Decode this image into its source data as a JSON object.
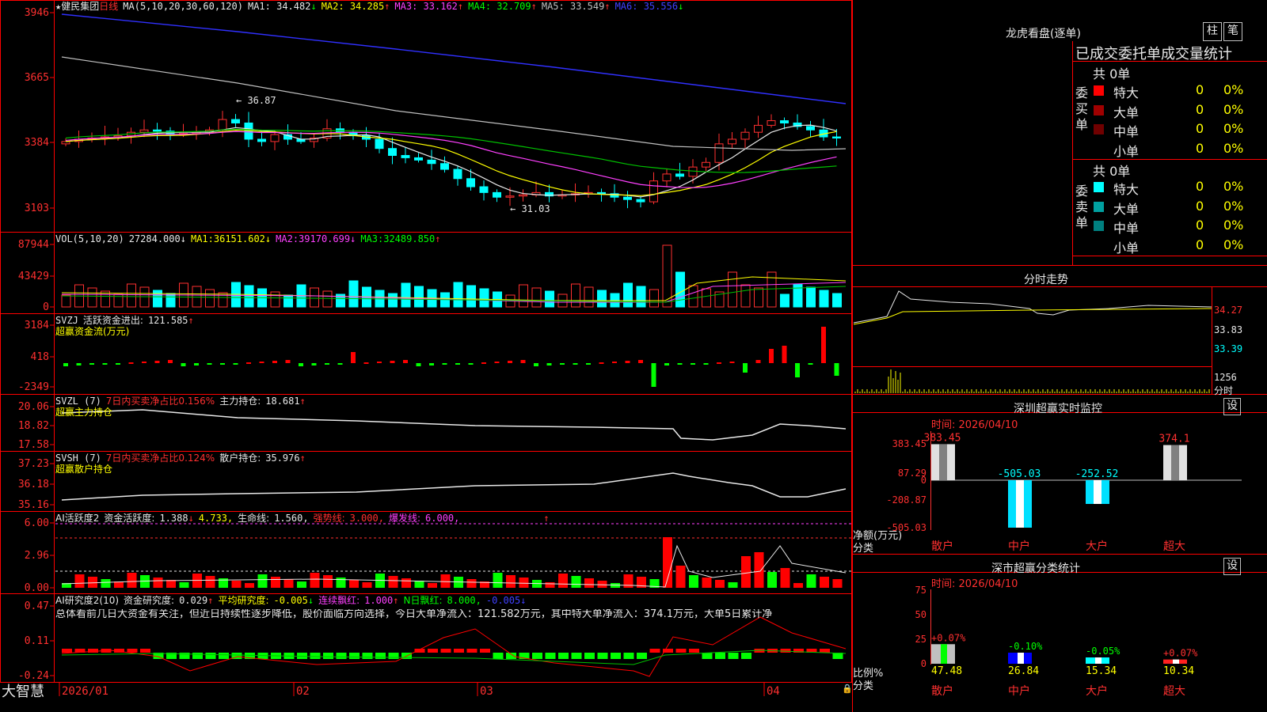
{
  "stock": {
    "star": "★",
    "name": "健民集团",
    "period": "日线"
  },
  "main_chart": {
    "ma_label": "MA(5,10,20,30,60,120)",
    "ma": [
      {
        "label": "MA1:",
        "value": "34.482",
        "arrow": "↓",
        "color": "#e8e8e8"
      },
      {
        "label": "MA2:",
        "value": "34.285",
        "arrow": "↑",
        "color": "#ffff00"
      },
      {
        "label": "MA3:",
        "value": "33.162",
        "arrow": "↑",
        "color": "#ff40ff"
      },
      {
        "label": "MA4:",
        "value": "32.709",
        "arrow": "↑",
        "color": "#00ff00"
      },
      {
        "label": "MA5:",
        "value": "33.549",
        "arrow": "↑",
        "color": "#c0c0c0"
      },
      {
        "label": "MA6:",
        "value": "35.556",
        "arrow": "↓",
        "color": "#4040ff"
      }
    ],
    "yticks": [
      "3946",
      "3665",
      "3384",
      "3103"
    ],
    "high_mark": "36.87",
    "low_mark": "31.03"
  },
  "vol": {
    "label": "VOL(5,10,20)",
    "value": "27284.000",
    "arrow": "↓",
    "ma": [
      {
        "label": "MA1:",
        "value": "36151.602",
        "arrow": "↓"
      },
      {
        "label": "MA2:",
        "value": "39170.699",
        "arrow": "↓"
      },
      {
        "label": "MA3:",
        "value": "32489.850",
        "arrow": "↑"
      }
    ],
    "yticks": [
      "87944",
      "43429",
      "0"
    ]
  },
  "svzj": {
    "label": "SVZJ",
    "title": "活跃资金进出:",
    "value": "121.585",
    "arrow": "↑",
    "sub": "超赢资金流(万元)",
    "yticks": [
      "3184",
      "418",
      "-2349"
    ]
  },
  "svzl": {
    "label": "SVZL (7)",
    "ratio_text": "7日内买卖净占比0.156%",
    "title": "主力持仓:",
    "value": "18.681",
    "arrow": "↑",
    "sub": "超赢主力持仓",
    "yticks": [
      "20.06",
      "18.82",
      "17.58"
    ]
  },
  "svsh": {
    "label": "SVSH (7)",
    "ratio_text": "7日内买卖净占比0.124%",
    "title": "散户持仓:",
    "value": "35.976",
    "arrow": "↑",
    "sub": "超赢散户持仓",
    "yticks": [
      "37.23",
      "36.18",
      "35.16"
    ]
  },
  "ai_active": {
    "label": "AI活跃度2",
    "title": "资金活跃度:",
    "value": "1.388",
    "arrow": "↓",
    "v2": "4.733,",
    "life": "生命线:",
    "life_value": "1.560,",
    "strong": "强势线:",
    "strong_value": "3.000,",
    "burst": "爆发线:",
    "burst_value": "6.000,",
    "tail_arrow": "↑",
    "yticks": [
      "6.00",
      "2.96",
      "0.00"
    ]
  },
  "ai_research": {
    "label": "AI研究度2(10)",
    "title": "资金研究度:",
    "value": "0.029",
    "arrow": "↑",
    "avg": "平均研究度:",
    "avg_value": "-0.005",
    "avg_arrow": "↓",
    "lian": "连续飘红:",
    "lian_value": "1.000",
    "lian_arrow": "↑",
    "n": "N日飘红:",
    "n_value": "8.000,",
    "tail": "-0.005",
    "tail_arrow": "↓",
    "summary": "总体看前几日大资金有关注，但近日持续性逐步降低，股价面临方向选择，今日大单净流入：121.582万元，其中特大单净流入：374.1万元，大单5日累计净",
    "yticks": [
      "0.47",
      "0.11",
      "-0.24"
    ]
  },
  "xaxis": {
    "brand": "大智慧",
    "labels": [
      "2026/01",
      "02",
      "03",
      "04"
    ]
  },
  "dragon": {
    "title": "龙虎看盘(逐单)",
    "btn1": "柱",
    "btn2": "笔",
    "header": "已成交委托单成交量统计",
    "buy": {
      "side": "委\n买\n单",
      "total": "共 0单",
      "rows": [
        {
          "name": "特大",
          "n": "0",
          "p": "0%",
          "color": "#ff0000"
        },
        {
          "name": "大单",
          "n": "0",
          "p": "0%",
          "color": "#a00000"
        },
        {
          "name": "中单",
          "n": "0",
          "p": "0%",
          "color": "#700000"
        },
        {
          "name": "小单",
          "n": "0",
          "p": "0%",
          "color": ""
        }
      ]
    },
    "sell": {
      "side": "委\n卖\n单",
      "total": "共 0单",
      "rows": [
        {
          "name": "特大",
          "n": "0",
          "p": "0%",
          "color": "#00ffff"
        },
        {
          "name": "大单",
          "n": "0",
          "p": "0%",
          "color": "#00a0a0"
        },
        {
          "name": "中单",
          "n": "0",
          "p": "0%",
          "color": "#008080"
        },
        {
          "name": "小单",
          "n": "0",
          "p": "0%",
          "color": ""
        }
      ]
    }
  },
  "intraday": {
    "title": "分时走势",
    "prices": [
      "34.27",
      "33.83",
      "33.39"
    ],
    "vol": "1256",
    "unit": "分时"
  },
  "monitor": {
    "title": "深圳超赢实时监控",
    "btn": "设",
    "time": "时间: 2026/04/10",
    "yticks": [
      "383.45",
      "87.29",
      "0",
      "-208.87",
      "-505.03"
    ],
    "ylabel": "净额(万元)",
    "xlabel": "分类",
    "bars": [
      {
        "cat": "散户",
        "value": "383.45"
      },
      {
        "cat": "中户",
        "value": "-505.03"
      },
      {
        "cat": "大户",
        "value": "-252.52"
      },
      {
        "cat": "超大",
        "value": "374.1"
      }
    ]
  },
  "classify": {
    "title": "深市超赢分类统计",
    "btn": "设",
    "time": "时间: 2026/04/10",
    "yticks": [
      "75",
      "50",
      "25",
      "0"
    ],
    "ylabel": "比例%",
    "xlabel": "分类",
    "bars": [
      {
        "cat": "散户",
        "value": "47.48",
        "delta": "+0.07%"
      },
      {
        "cat": "中户",
        "value": "26.84",
        "delta": "-0.10%"
      },
      {
        "cat": "大户",
        "value": "15.34",
        "delta": "-0.05%"
      },
      {
        "cat": "超大",
        "value": "10.34",
        "delta": "+0.07%"
      }
    ]
  },
  "chart_data": {
    "type": "line",
    "title": "健民集团 日线",
    "ylim": [
      3103,
      3946
    ],
    "series": [
      {
        "name": "MA6",
        "values": [
          35.556
        ]
      }
    ]
  }
}
